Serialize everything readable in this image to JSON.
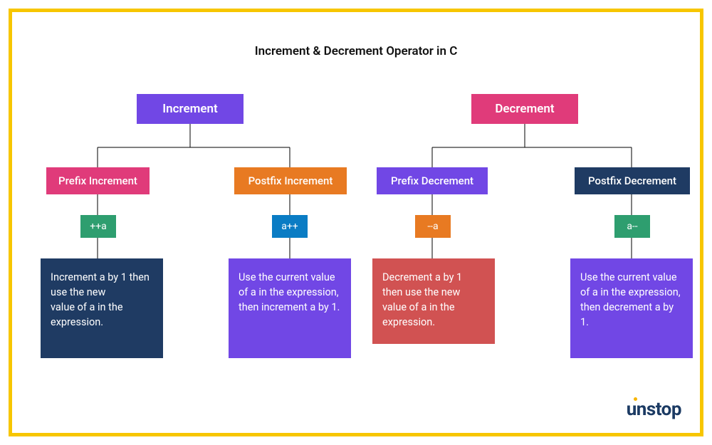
{
  "title": "Increment & Decrement Operator in C",
  "root_increment": "Increment",
  "root_decrement": "Decrement",
  "prefix_inc_label": "Prefix Increment",
  "postfix_inc_label": "Postfix Increment",
  "prefix_dec_label": "Prefix Decrement",
  "postfix_dec_label": "Postfix Decrement",
  "prefix_inc_chip": "++a",
  "postfix_inc_chip": "a++",
  "prefix_dec_chip": "--a",
  "postfix_dec_chip": "a--",
  "prefix_inc_desc": "Increment a by 1 then use the new\nvalue of a in the expression.",
  "postfix_inc_desc": "Use the current value of a in the expression, then increment a by 1.",
  "prefix_dec_desc": "Decrement a by 1 then use the new value of a in the expression.",
  "postfix_dec_desc": "Use the current value of a in the expression, then decrement a by 1.",
  "brand": "unstop",
  "colors": {
    "border": "#f7c600",
    "violet": "#7147e5",
    "pink": "#e03b7a",
    "orange": "#e87a22",
    "navy": "#1f3b63",
    "red": "#d15252",
    "green": "#2e9e6f",
    "blue": "#0a7cc4",
    "descNavy": "#1f3b63",
    "descViolet": "#7147e5",
    "descRed": "#d15252"
  }
}
